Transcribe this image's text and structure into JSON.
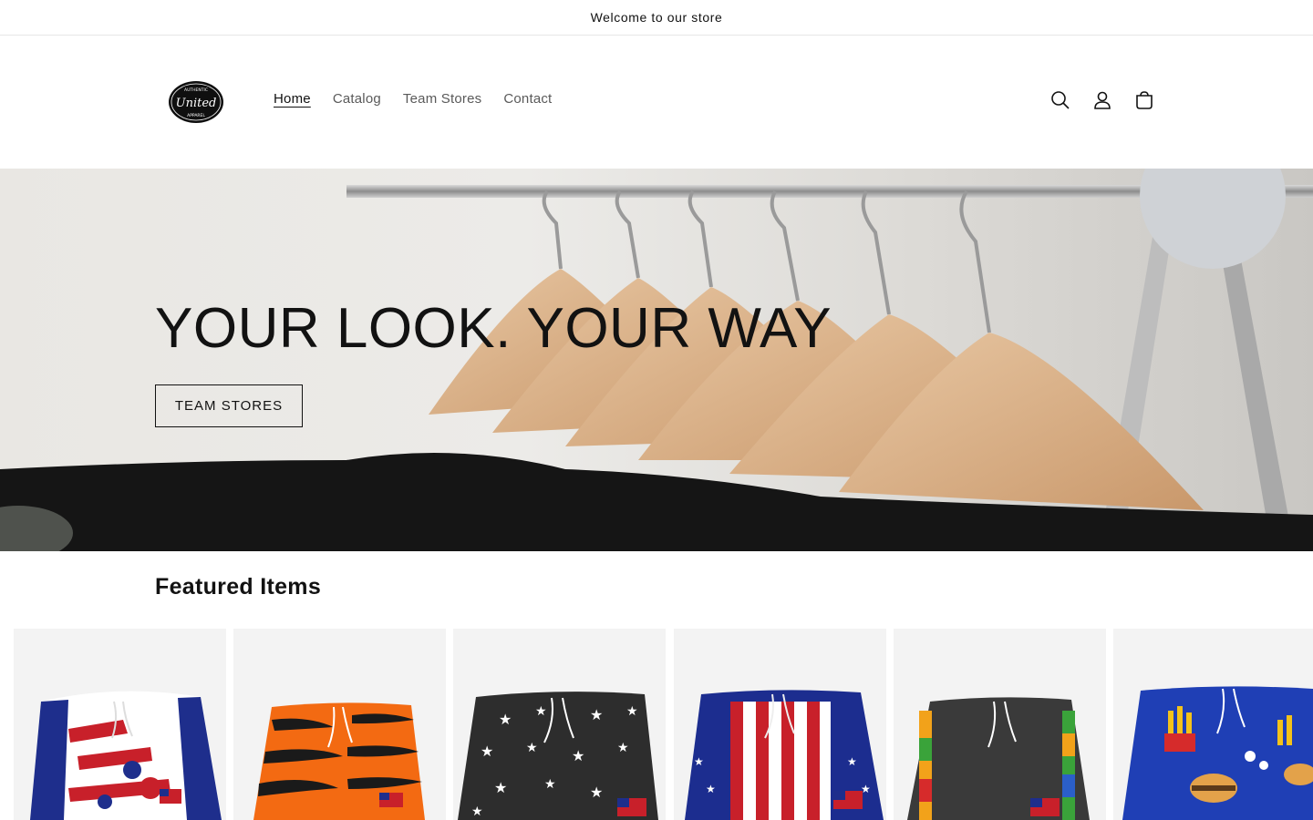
{
  "announcement": {
    "text": "Welcome to our store"
  },
  "header": {
    "logo": {
      "top_text": "AUTHENTIC",
      "main_text": "United",
      "bottom_text": "APPAREL"
    },
    "nav": [
      {
        "label": "Home",
        "active": true
      },
      {
        "label": "Catalog",
        "active": false
      },
      {
        "label": "Team Stores",
        "active": false
      },
      {
        "label": "Contact",
        "active": false
      }
    ],
    "icons": [
      "search-icon",
      "account-icon",
      "cart-icon"
    ]
  },
  "hero": {
    "title": "YOUR LOOK. YOUR WAY",
    "button_label": "TEAM STORES"
  },
  "featured": {
    "title": "Featured Items",
    "products": [
      {
        "image": "usa-flag-shorts",
        "colors": [
          "#1e2e8c",
          "#c8202a",
          "#ffffff"
        ]
      },
      {
        "image": "tiger-stripe-shorts",
        "colors": [
          "#f36a12",
          "#1a1a1a"
        ]
      },
      {
        "image": "star-print-shorts",
        "colors": [
          "#2d2d2d",
          "#ffffff"
        ]
      },
      {
        "image": "stars-and-stripes-shorts",
        "colors": [
          "#1c2d8f",
          "#c8202a",
          "#ffffff"
        ]
      },
      {
        "image": "autism-puzzle-shorts",
        "colors": [
          "#3a3a3a",
          "#f2a21a",
          "#3aa33a",
          "#d62b2b",
          "#2b5fc9"
        ]
      },
      {
        "image": "fries-burger-shorts",
        "colors": [
          "#1f3fb5",
          "#f3c21a",
          "#d62b2b"
        ]
      }
    ]
  }
}
